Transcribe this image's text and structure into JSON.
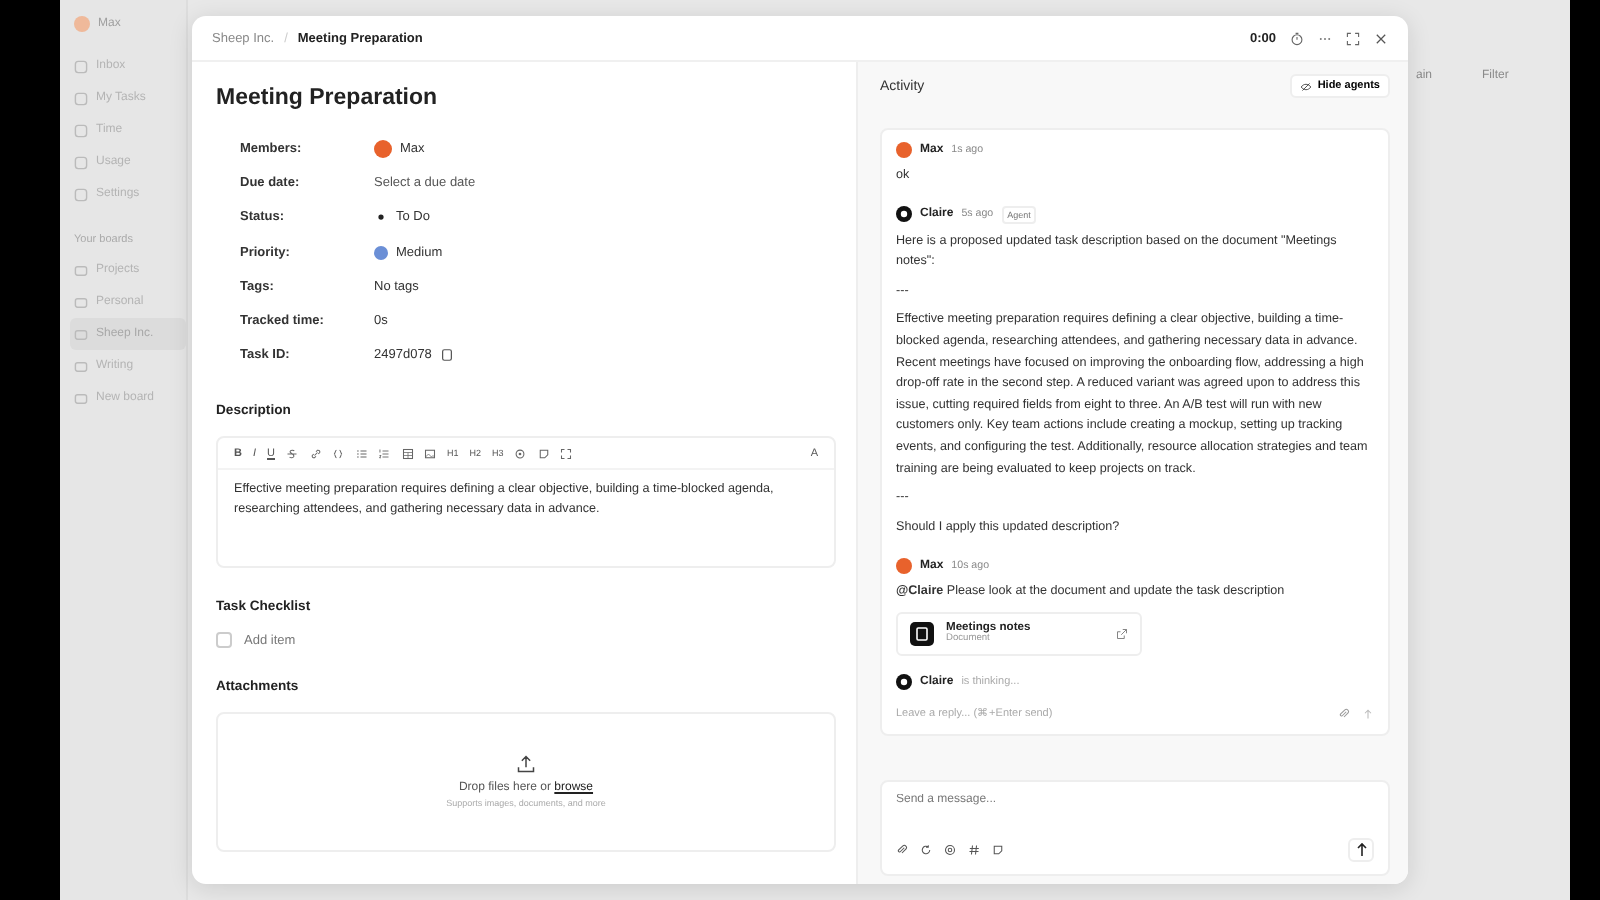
{
  "sidebar": {
    "user": "Max",
    "items": [
      {
        "label": "Inbox",
        "selected": false
      },
      {
        "label": "My Tasks",
        "selected": false
      },
      {
        "label": "Time",
        "selected": false
      },
      {
        "label": "Usage",
        "selected": false
      },
      {
        "label": "Settings",
        "selected": false
      }
    ],
    "boards_heading": "Your boards",
    "boards": [
      {
        "label": "Projects",
        "selected": false
      },
      {
        "label": "Personal",
        "selected": false
      },
      {
        "label": "Sheep Inc.",
        "selected": true
      },
      {
        "label": "Writing",
        "selected": false
      },
      {
        "label": "New board",
        "selected": false
      }
    ]
  },
  "backdrop": {
    "button_1": "ain",
    "button_2": "Filter"
  },
  "modal": {
    "breadcrumb": [
      "Sheep Inc.",
      "Meeting Preparation"
    ],
    "breadcrumb_separator": "/",
    "timer": "0:00",
    "title": "Meeting Preparation",
    "fields": [
      {
        "label": "Members:",
        "kind": "member",
        "value": "Max"
      },
      {
        "label": "Due date:",
        "kind": "text",
        "value": "Select a due date"
      },
      {
        "label": "Status:",
        "kind": "status",
        "value": "To Do"
      },
      {
        "label": "Priority:",
        "kind": "priority",
        "value": "Medium",
        "color": "#6b8fd6"
      },
      {
        "label": "Tags:",
        "kind": "text",
        "value": "No tags"
      },
      {
        "label": "Tracked time:",
        "kind": "text",
        "value": "0s"
      },
      {
        "label": "Task ID:",
        "kind": "id",
        "value": "2497d078"
      }
    ],
    "description": {
      "heading": "Description",
      "toolbar": [
        "B",
        "I",
        "U",
        "H1",
        "H2",
        "H3",
        "A"
      ],
      "text": "Effective meeting preparation requires defining a clear objective, building a time-blocked agenda, researching attendees, and gathering necessary data in advance."
    },
    "checklist": {
      "heading": "Task Checklist",
      "add_label": "Add item",
      "checked": false
    },
    "attachments": {
      "heading": "Attachments",
      "prompt": "Drop files here or",
      "link": "browse",
      "hint": "Supports images, documents, and more"
    },
    "activity": {
      "heading": "Activity",
      "hide_button": "Hide agents",
      "messages": [
        {
          "kind": "user",
          "author": "Max",
          "time": "1s ago",
          "lines": [
            "ok"
          ]
        },
        {
          "kind": "agent",
          "author": "Claire",
          "time": "5s ago",
          "badge": "Agent",
          "lines": [
            "Here is a proposed updated task description based on the document \"Meetings notes\":",
            "---",
            "Effective meeting preparation requires defining a clear objective, building a time-blocked agenda, researching attendees, and gathering necessary data in advance. Recent meetings have focused on improving the onboarding flow, addressing a high drop-off rate in the second step. A reduced variant was agreed upon to address this issue, cutting required fields from eight to three. An A/B test will run with new customers only. Key team actions include creating a mockup, setting up tracking events, and configuring the test. Additionally, resource allocation strategies and team training are being evaluated to keep projects on track.",
            "---",
            "Should I apply this updated description?"
          ]
        },
        {
          "kind": "user",
          "author": "Max",
          "time": "10s ago",
          "lines": [
            "**@Claire** Please look at the document and update the task description"
          ],
          "attachment": {
            "title": "Meetings notes",
            "subtitle": "Document"
          }
        }
      ],
      "thinking": {
        "author": "Claire",
        "text": "is thinking..."
      },
      "reply_placeholder": "Leave a reply... (⌘+Enter send)",
      "composer_placeholder": "Send a message..."
    }
  }
}
